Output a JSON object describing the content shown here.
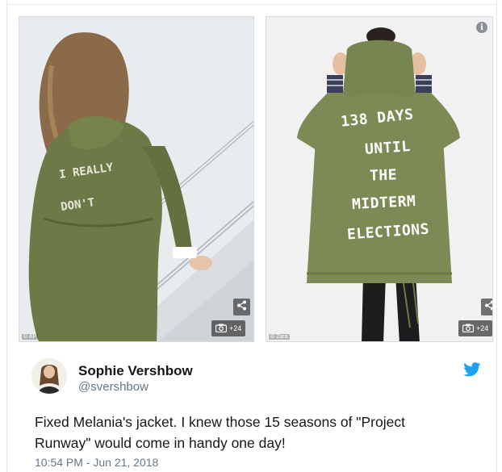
{
  "embed": {
    "photos": [
      {
        "credit": "© AP",
        "gallery_count": "+24"
      },
      {
        "credit": "© Zara",
        "gallery_count": "+24"
      }
    ],
    "jacket_slogan": [
      "138 DAYS",
      "UNTIL",
      "THE",
      "MIDTERM",
      "ELECTIONS"
    ]
  },
  "tweet": {
    "author_name": "Sophie Vershbow",
    "author_handle": "@svershbow",
    "text_line1": "Fixed Melania's jacket. I knew those 15 seasons of \"Project",
    "text_line2": "Runway\" would come in handy one day!",
    "timestamp": "10:54 PM - Jun 21, 2018"
  },
  "colors": {
    "jacket": "#7d8a55",
    "twitter_blue": "#1da1f2",
    "handle_gray": "#657786"
  },
  "icons": [
    "share-icon",
    "camera-icon",
    "info-icon",
    "twitter-bird-icon"
  ]
}
